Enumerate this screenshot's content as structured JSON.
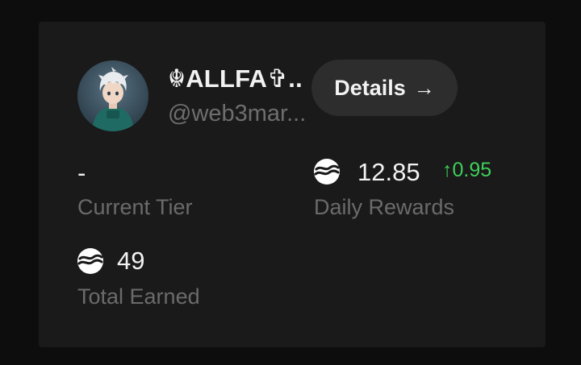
{
  "profile": {
    "display_name": "☬ALLFA✞..",
    "handle": "@web3mar..."
  },
  "details_button": {
    "label": "Details",
    "arrow": "→"
  },
  "stats": {
    "current_tier": {
      "value": "-",
      "label": "Current Tier"
    },
    "daily_rewards": {
      "value": "12.85",
      "change": "↑0.95",
      "label": "Daily Rewards"
    },
    "total_earned": {
      "value": "49",
      "label": "Total Earned"
    }
  },
  "colors": {
    "background": "#0d0d0d",
    "card": "#1a1a1a",
    "button": "#2d2d2d",
    "positive": "#3ecf5a",
    "muted_text": "#6b6b6b"
  },
  "icons": {
    "token": "token-icon",
    "arrow": "arrow-right-icon"
  }
}
